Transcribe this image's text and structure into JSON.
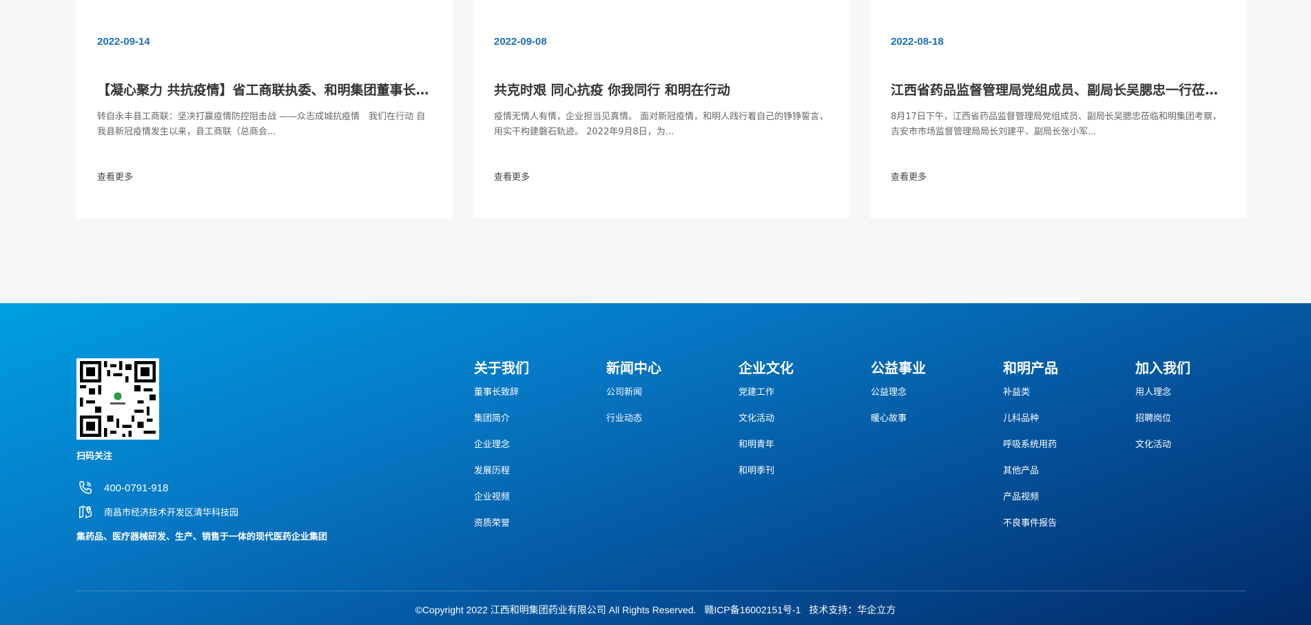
{
  "news": [
    {
      "date": "2022-09-14",
      "title": "【凝心聚力 共抗疫情】省工商联执委、和明集团董事长…",
      "excerpt": "转自永丰县工商联：坚决打赢疫情防控阻击战 ——众志成城抗疫情　我们在行动 自我县新冠疫情发生以来，县工商联（总商会...",
      "more": "查看更多"
    },
    {
      "date": "2022-09-08",
      "title": "共克时艰 同心抗疫 你我同行 和明在行动",
      "excerpt": "疫情无情人有情，企业担当见真情。 面对新冠疫情，和明人践行着自己的铮铮誓言，用实干构建磐石轨迹。 2022年9月8日，为...",
      "more": "查看更多"
    },
    {
      "date": "2022-08-18",
      "title": "江西省药品监督管理局党组成员、副局长吴腮忠一行莅临…",
      "excerpt": "8月17日下午，江西省药品监督管理局党组成员、副局长吴腮忠莅临和明集团考察，吉安市市场监督管理局局长刘建平、副局长张小军...",
      "more": "查看更多"
    }
  ],
  "footer": {
    "qr_label": "扫码关注",
    "phone": "400-0791-918",
    "address": "南昌市经济技术开发区清华科技园",
    "tagline": "集药品、医疗器械研发、生产、销售于一体的现代医药企业集团",
    "nav": [
      {
        "heading": "关于我们",
        "links": [
          "董事长致辞",
          "集团简介",
          "企业理念",
          "发展历程",
          "企业视频",
          "资质荣誉"
        ]
      },
      {
        "heading": "新闻中心",
        "links": [
          "公司新闻",
          "行业动态"
        ]
      },
      {
        "heading": "企业文化",
        "links": [
          "党建工作",
          "文化活动",
          "和明青年",
          "和明季刊"
        ]
      },
      {
        "heading": "公益事业",
        "links": [
          "公益理念",
          "暖心故事"
        ]
      },
      {
        "heading": "和明产品",
        "links": [
          "补益类",
          "儿科品种",
          "呼吸系统用药",
          "其他产品",
          "产品视频",
          "不良事件报告"
        ]
      },
      {
        "heading": "加入我们",
        "links": [
          "用人理念",
          "招聘岗位",
          "文化活动"
        ]
      }
    ],
    "copyright": "©Copyright 2022 江西和明集团药业有限公司 All Rights Reserved.",
    "icp": "赣ICP备16002151号-1",
    "tech_support": "技术支持：华企立方"
  },
  "colors": {
    "date_accent": "#1a6fb5",
    "footer_gradient_start": "#009fe3",
    "footer_gradient_end": "#022a66"
  },
  "icons": {
    "phone": "phone-icon",
    "address": "map-icon",
    "qr": "qr-code-icon"
  }
}
